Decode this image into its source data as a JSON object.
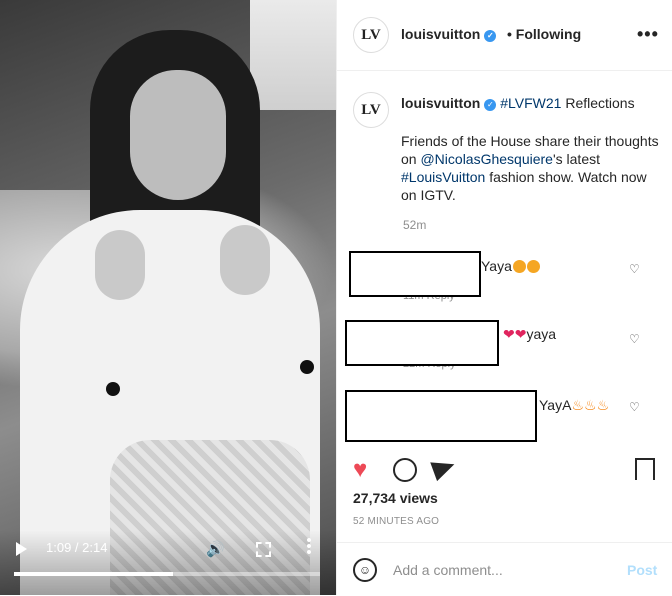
{
  "video": {
    "current_time": "1:09",
    "duration": "2:14",
    "time_text": "1:09 / 2:14",
    "progress": 0.52
  },
  "header": {
    "avatar_text": "LV",
    "username": "louisvuitton",
    "separator": "•",
    "follow_label": "Following",
    "more_label": "•••"
  },
  "caption": {
    "avatar_text": "LV",
    "username": "louisvuitton",
    "hashtag1": "#LVFW21",
    "text1": " Reflections",
    "text2": "Friends of the House share their thoughts on ",
    "mention": "@NicolasGhesquiere",
    "text3": "'s latest ",
    "hashtag2": "#LouisVuitton",
    "text4": " fashion show. Watch now on IGTV.",
    "time_ago": "52m"
  },
  "comments": [
    {
      "text": "Yaya",
      "emojis": [
        "heart-eyes-emoji",
        "heart-eyes-emoji"
      ],
      "sub": "11m   Reply"
    },
    {
      "text": "yaya",
      "emojis": [
        "red-heart-emoji",
        "red-heart-emoji"
      ],
      "sub": "22m   Reply"
    },
    {
      "text": "YayA",
      "emojis": [
        "fire-emoji",
        "fire-emoji",
        "fire-emoji"
      ],
      "sub": ""
    }
  ],
  "actions": {
    "like_icon": "heart-filled-icon",
    "comment_icon": "comment-icon",
    "share_icon": "send-icon",
    "save_icon": "bookmark-icon",
    "liked_color": "#ed4956"
  },
  "views": "27,734 views",
  "post_time": "52 MINUTES AGO",
  "add_comment": {
    "placeholder": "Add a comment...",
    "post_label": "Post"
  }
}
